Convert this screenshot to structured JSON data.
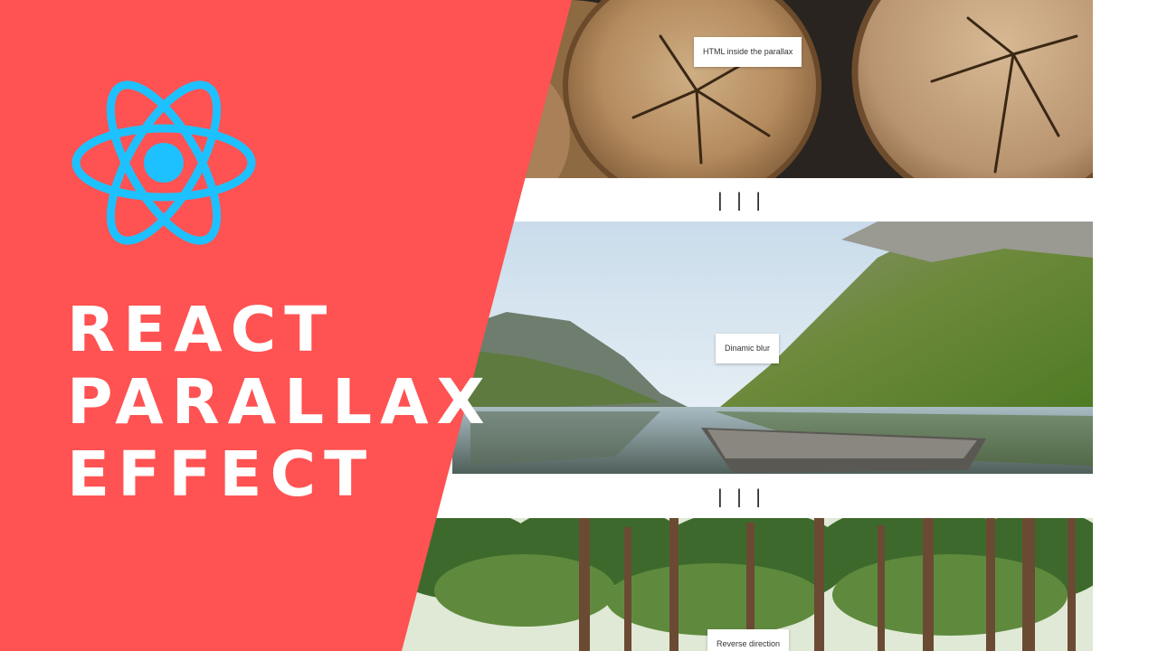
{
  "banner": {
    "title_lines": [
      "REACT",
      "PARALLAX",
      "EFFECT"
    ],
    "logo_icon": "react-atom-icon",
    "colors": {
      "background": "#ff5252",
      "logo": "#1ec1ff",
      "title": "#ffffff"
    }
  },
  "demo": {
    "sections": [
      {
        "image": "wooden-logs",
        "caption": "HTML inside the parallax"
      },
      {
        "image": "mountain-lake-with-boat",
        "caption": "Dinamic blur"
      },
      {
        "image": "pine-forest",
        "caption": "Reverse direction"
      }
    ],
    "dividers": [
      "| | |",
      "| | |"
    ]
  }
}
